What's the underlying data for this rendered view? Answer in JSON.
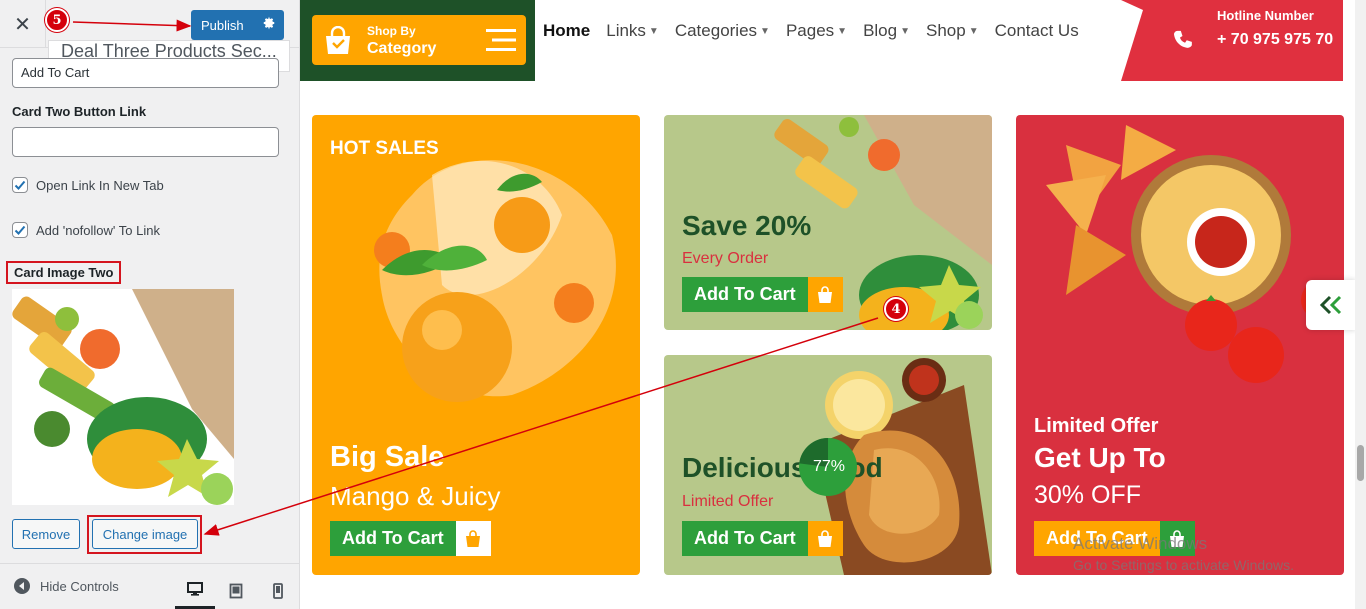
{
  "sidebar": {
    "close_icon": "close-icon",
    "publish_label": "Publish",
    "section_title": "Deal Three Products Sec...",
    "card_one_button_text_value": "Add To Cart",
    "card_two_link_label": "Card Two Button Link",
    "card_two_link_value": "",
    "open_new_tab_label": "Open Link In New Tab",
    "open_new_tab_checked": true,
    "nofollow_label": "Add 'nofollow' To Link",
    "nofollow_checked": true,
    "card_image_label": "Card Image Two",
    "remove_label": "Remove",
    "change_image_label": "Change image",
    "hide_controls_label": "Hide Controls",
    "devices": [
      "desktop-icon",
      "tablet-icon",
      "mobile-icon"
    ]
  },
  "annotations": {
    "step_a": "5",
    "step_b": "4"
  },
  "preview": {
    "shop_by": "Shop By",
    "category": "Category",
    "nav": [
      {
        "label": "Home",
        "active": true,
        "dropdown": false
      },
      {
        "label": "Links",
        "dropdown": true
      },
      {
        "label": "Categories",
        "dropdown": true
      },
      {
        "label": "Pages",
        "dropdown": true
      },
      {
        "label": "Blog",
        "dropdown": true
      },
      {
        "label": "Shop",
        "dropdown": true
      },
      {
        "label": "Contact Us",
        "dropdown": false
      }
    ],
    "hotline_title": "Hotline Number",
    "hotline_number": "+ 70 975 975 70",
    "cards": {
      "c1": {
        "tag": "HOT SALES",
        "title": "Big Sale",
        "subtitle": "Mango & Juicy",
        "button": "Add To Cart"
      },
      "c2": {
        "title": "Save 20%",
        "subtitle": "Every Order",
        "button": "Add To Cart"
      },
      "c3": {
        "title": "Delicious Food",
        "subtitle": "Limited Offer",
        "button": "Add To Cart",
        "progress_label": "77%",
        "progress": 0.77
      },
      "c4": {
        "tag": "Limited Offer",
        "title": "Get Up To",
        "subtitle": "30% OFF",
        "button": "Add To Cart"
      }
    },
    "watermark_line1": "Activate Windows",
    "watermark_line2": "Go to Settings to activate Windows."
  },
  "colors": {
    "accent": "#2271b1",
    "orange": "#ffa500",
    "green": "#2d9f3b",
    "dark_green": "#1e5128",
    "red": "#d9303f",
    "annotation_red": "#d4000b"
  }
}
